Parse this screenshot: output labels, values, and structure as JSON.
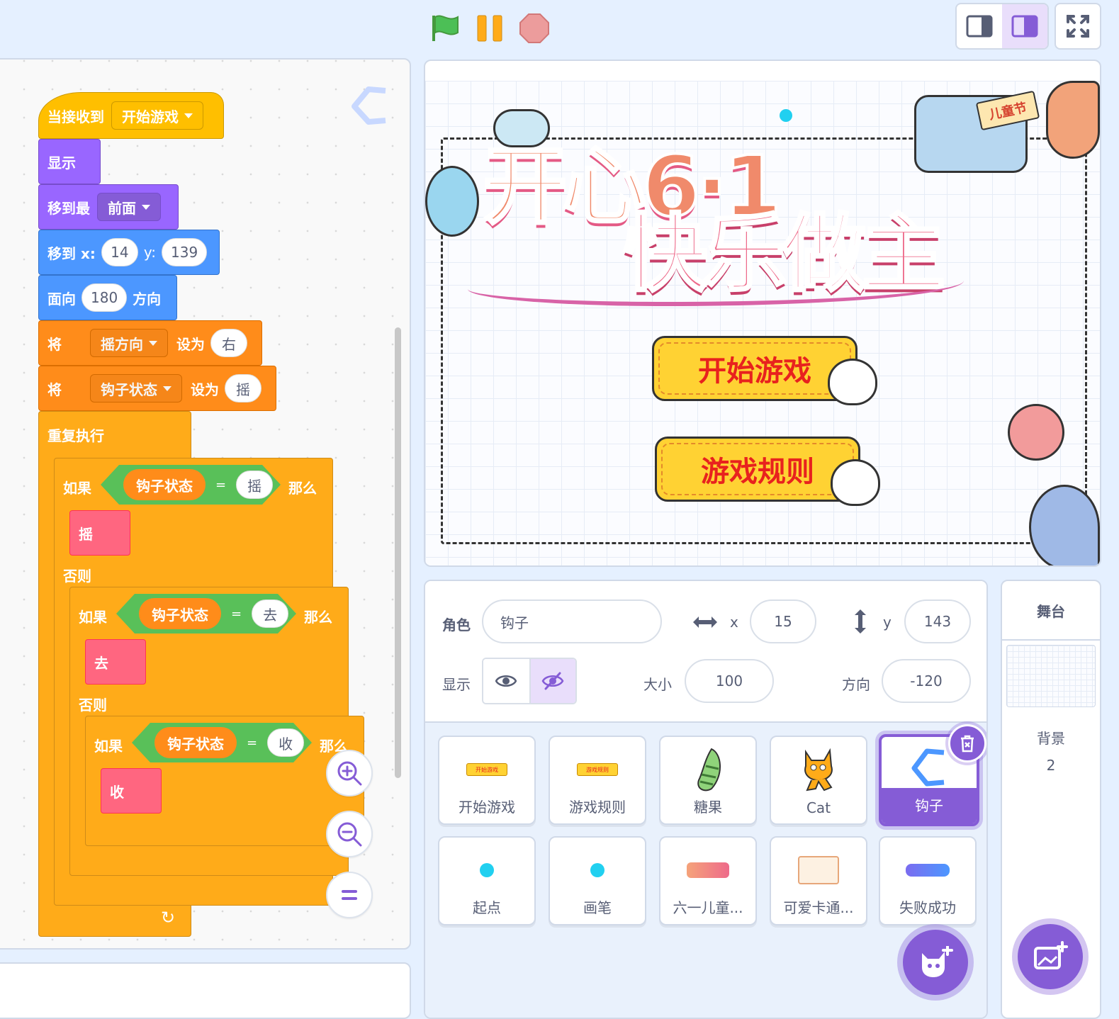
{
  "code": {
    "hat": {
      "label": "当接收到",
      "message": "开始游戏"
    },
    "show": "显示",
    "go_to_front": {
      "label": "移到最",
      "option": "前面"
    },
    "go_to_xy": {
      "label": "移到 x:",
      "x": "14",
      "y_label": "y:",
      "y": "139"
    },
    "point": {
      "label": "面向",
      "value": "180",
      "suffix": "方向"
    },
    "set1": {
      "label": "将",
      "var": "摇方向",
      "to": "设为",
      "value": "右"
    },
    "set2": {
      "label": "将",
      "var": "钩子状态",
      "to": "设为",
      "value": "摇"
    },
    "forever": "重复执行",
    "if1": {
      "label": "如果",
      "var": "钩子状态",
      "eq": "=",
      "value": "摇",
      "then": "那么",
      "body": "摇",
      "else": "否则"
    },
    "if2": {
      "label": "如果",
      "var": "钩子状态",
      "eq": "=",
      "value": "去",
      "then": "那么",
      "body": "去",
      "else": "否则"
    },
    "if3": {
      "label": "如果",
      "var": "钩子状态",
      "eq": "=",
      "value": "收",
      "then": "那么",
      "body": "收"
    },
    "loop_arrow": "↻"
  },
  "stage": {
    "title_line1": "开心6·1",
    "title_line2": "快乐做主",
    "badge": "儿童节",
    "button_start": "开始游戏",
    "button_rules": "游戏规则"
  },
  "sprite_info": {
    "sprite_label": "角色",
    "sprite_name": "钩子",
    "x_label": "x",
    "x": "15",
    "y_label": "y",
    "y": "143",
    "show_label": "显示",
    "size_label": "大小",
    "size": "100",
    "direction_label": "方向",
    "direction": "-120"
  },
  "sprites": [
    {
      "name": "开始游戏",
      "thumb": "button-start"
    },
    {
      "name": "游戏规则",
      "thumb": "button-rules"
    },
    {
      "name": "糖果",
      "thumb": "candy"
    },
    {
      "name": "Cat",
      "thumb": "cat"
    },
    {
      "name": "钩子",
      "thumb": "hook",
      "selected": true
    },
    {
      "name": "起点",
      "thumb": "dot"
    },
    {
      "name": "画笔",
      "thumb": "dot"
    },
    {
      "name": "六一儿童...",
      "thumb": "title-art"
    },
    {
      "name": "可爱卡通...",
      "thumb": "card"
    },
    {
      "name": "失败成功",
      "thumb": "logo-text"
    }
  ],
  "stage_selector": {
    "header": "舞台",
    "backdrops_label": "背景",
    "backdrops_count": "2"
  },
  "colors": {
    "events": "#ffbf00",
    "looks": "#9966ff",
    "motion": "#4c97ff",
    "variables": "#ff8c1a",
    "control": "#ffab19",
    "operators": "#59c059",
    "custom": "#ff6680",
    "accent": "#855cd6"
  }
}
